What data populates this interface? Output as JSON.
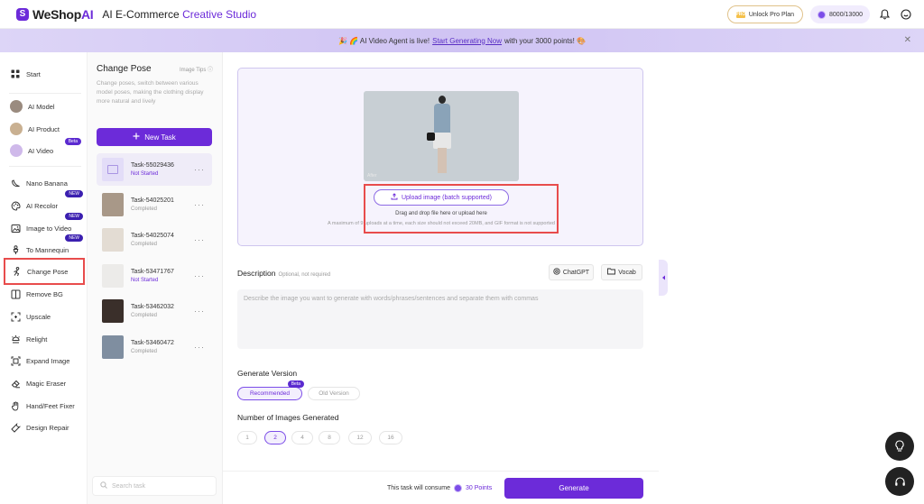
{
  "header": {
    "logo_main": "WeShop",
    "logo_ai": "AI",
    "title_prefix": "AI E-Commerce",
    "title_accent": "Creative Studio",
    "pro_icon": "PRO",
    "pro_label": "Unlock Pro Plan",
    "points": "8000/13000"
  },
  "banner": {
    "prefix": "🎉 🌈 AI Video Agent is live!",
    "link": "Start Generating Now",
    "suffix": "with your 3000 points! 🎨",
    "close": "✕"
  },
  "sidebar": {
    "start": "Start",
    "ai_model": "AI Model",
    "ai_product": "AI Product",
    "ai_video": "AI Video",
    "beta": "Beta",
    "new": "NEW",
    "nano_banana": "Nano Banana",
    "ai_recolor": "AI Recolor",
    "image_to_video": "Image to Video",
    "to_mannequin": "To Mannequin",
    "change_pose": "Change Pose",
    "remove_bg": "Remove BG",
    "upscale": "Upscale",
    "relight": "Relight",
    "expand_image": "Expand Image",
    "magic_eraser": "Magic Eraser",
    "hand_feet_fixer": "Hand/Feet Fixer",
    "design_repair": "Design Repair"
  },
  "tasks_panel": {
    "title": "Change Pose",
    "image_tips": "Image Tips ⓘ",
    "description": "Change poses, switch between various model poses, making the clothing display more natural and lively",
    "new_task": "New Task",
    "search_placeholder": "Search task",
    "tasks": [
      {
        "name": "Task-55029436",
        "status": "Not Started"
      },
      {
        "name": "Task-54025201",
        "status": "Completed"
      },
      {
        "name": "Task-54025074",
        "status": "Completed"
      },
      {
        "name": "Task-53471767",
        "status": "Not Started"
      },
      {
        "name": "Task-53462032",
        "status": "Completed"
      },
      {
        "name": "Task-53460472",
        "status": "Completed"
      }
    ]
  },
  "upload": {
    "preview_label": "After",
    "button": "Upload image (batch supported)",
    "drag_text": "Drag and drop file here or upload here",
    "limit_text": "A maximum of 9 uploads at a time, each size should not exceed 20MB, and GIF format is not supported"
  },
  "description": {
    "label": "Description",
    "optional": "Optional, not required",
    "chatgpt": "ChatGPT",
    "vocab": "Vocab",
    "placeholder": "Describe the image you want to generate with words/phrases/sentences and separate them with commas"
  },
  "generate_version": {
    "label": "Generate Version",
    "recommended": "Recommended",
    "beta": "Beta",
    "old": "Old Version"
  },
  "num_images": {
    "label": "Number of Images Generated",
    "options": [
      "1",
      "2",
      "4",
      "8",
      "12",
      "16"
    ],
    "selected": "2"
  },
  "footer": {
    "consume_prefix": "This task will consume",
    "consume_points": "30 Points",
    "generate": "Generate"
  },
  "colors": {
    "accent": "#6c2bd9",
    "highlight": "#e84c4c"
  }
}
